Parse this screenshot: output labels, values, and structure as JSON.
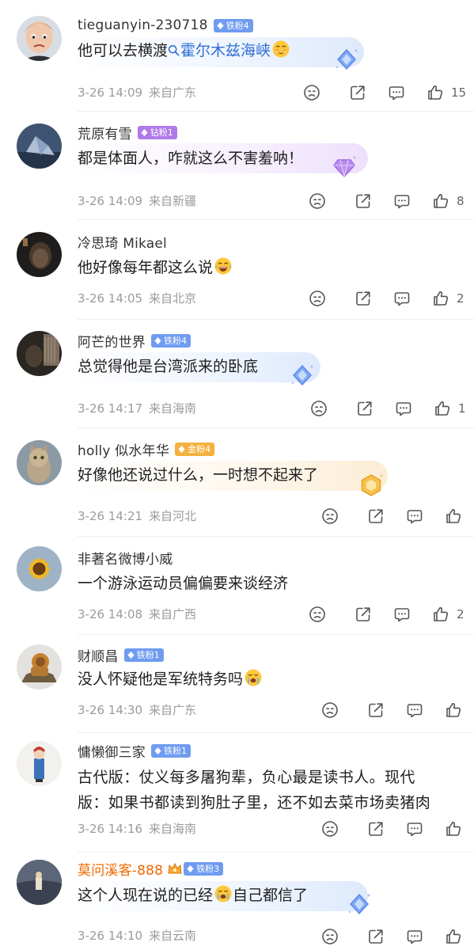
{
  "comments": [
    {
      "user": "tieguanyin-230718",
      "badge": "铁粉4",
      "badge_color": "#6f9cf0",
      "text_before": "他可以去横渡",
      "topic": "霍尔木兹海峡",
      "emoji": "emoji-shy-icon",
      "time": "3-26 14:09",
      "location": "来自广东",
      "likes": "15"
    },
    {
      "user": "荒原有雪",
      "badge": "钻粉1",
      "badge_color": "#b07ae8",
      "text": "都是体面人，咋就这么不害羞呐！",
      "time": "3-26 14:09",
      "location": "来自新疆",
      "likes": "8"
    },
    {
      "user": "冷思琦 Mikael",
      "text": "他好像每年都这么说",
      "emoji": "emoji-laugh-cry-icon",
      "time": "3-26 14:05",
      "location": "来自北京",
      "likes": "2"
    },
    {
      "user": "阿芒的世界",
      "badge": "铁粉4",
      "badge_color": "#6f9cf0",
      "text": "总觉得他是台湾派来的卧底",
      "time": "3-26 14:17",
      "location": "来自海南",
      "likes": "1"
    },
    {
      "user": "holly 似水年华",
      "badge": "金粉4",
      "badge_color": "#f4b13f",
      "text": "好像他还说过什么，一时想不起来了",
      "time": "3-26 14:21",
      "location": "来自河北",
      "likes": ""
    },
    {
      "user": "非著名微博小威",
      "text": "一个游泳运动员偏偏要来谈经济",
      "time": "3-26 14:08",
      "location": "来自广西",
      "likes": "2"
    },
    {
      "user": "财顺昌",
      "badge": "铁粉1",
      "badge_color": "#6f9cf0",
      "text": "没人怀疑他是军统特务吗",
      "emoji": "emoji-crying-icon",
      "time": "3-26 14:30",
      "location": "来自广东",
      "likes": ""
    },
    {
      "user": "慵懒御三家",
      "badge": "铁粉1",
      "badge_color": "#6f9cf0",
      "text_line1": "古代版：仗义每多屠狗辈，负心最是读书人。现代",
      "text_line2": "版：如果书都读到狗肚子里，还不如去菜市场卖猪肉",
      "time": "3-26 14:16",
      "location": "来自海南",
      "likes": ""
    },
    {
      "user": "莫问溪客-888",
      "badge": "铁粉3",
      "badge_color": "#6f9cf0",
      "text_before": "这个人现在说的已经",
      "emoji": "emoji-crying-icon",
      "text_after": "自己都信了",
      "time": "3-26 14:10",
      "location": "来自云南",
      "likes": ""
    }
  ]
}
